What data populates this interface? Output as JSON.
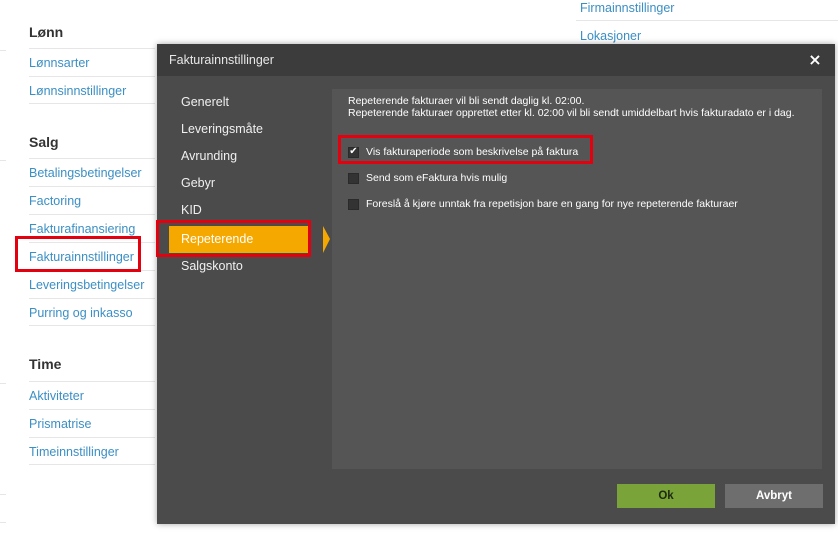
{
  "background": {
    "sections": [
      {
        "title": "Lønn",
        "links": [
          "Lønnsarter",
          "Lønnsinnstillinger"
        ]
      },
      {
        "title": "Salg",
        "links": [
          "Betalingsbetingelser",
          "Factoring",
          "Fakturafinansiering",
          "Fakturainnstillinger",
          "Leveringsbetingelser",
          "Purring og inkasso"
        ]
      },
      {
        "title": "Time",
        "links": [
          "Aktiviteter",
          "Prismatrise",
          "Timeinnstillinger"
        ]
      }
    ],
    "right_links": [
      "Firmainnstillinger",
      "Lokasjoner"
    ]
  },
  "modal": {
    "title": "Fakturainnstillinger",
    "close_symbol": "×",
    "nav": [
      "Generelt",
      "Leveringsmåte",
      "Avrunding",
      "Gebyr",
      "KID",
      "Repeterende",
      "Salgskonto"
    ],
    "active_nav": "Repeterende",
    "info_line1": "Repeterende fakturaer vil bli sendt daglig kl. 02:00.",
    "info_line2": "Repeterende fakturaer opprettet etter kl. 02:00 vil bli sendt umiddelbart hvis fakturadato er i dag.",
    "options": [
      {
        "label": "Vis fakturaperiode som beskrivelse på faktura",
        "checked": true
      },
      {
        "label": "Send som eFaktura hvis mulig",
        "checked": false
      },
      {
        "label": "Foreslå å kjøre unntak fra repetisjon bare en gang for nye repeterende fakturaer",
        "checked": false
      }
    ],
    "ok_label": "Ok",
    "cancel_label": "Avbryt"
  },
  "colors": {
    "link": "#3b8fc4",
    "modal_bg": "#4b4b4b",
    "active_nav": "#f5a800",
    "ok_button": "#7aa33a",
    "highlight_box": "#e3000f"
  }
}
